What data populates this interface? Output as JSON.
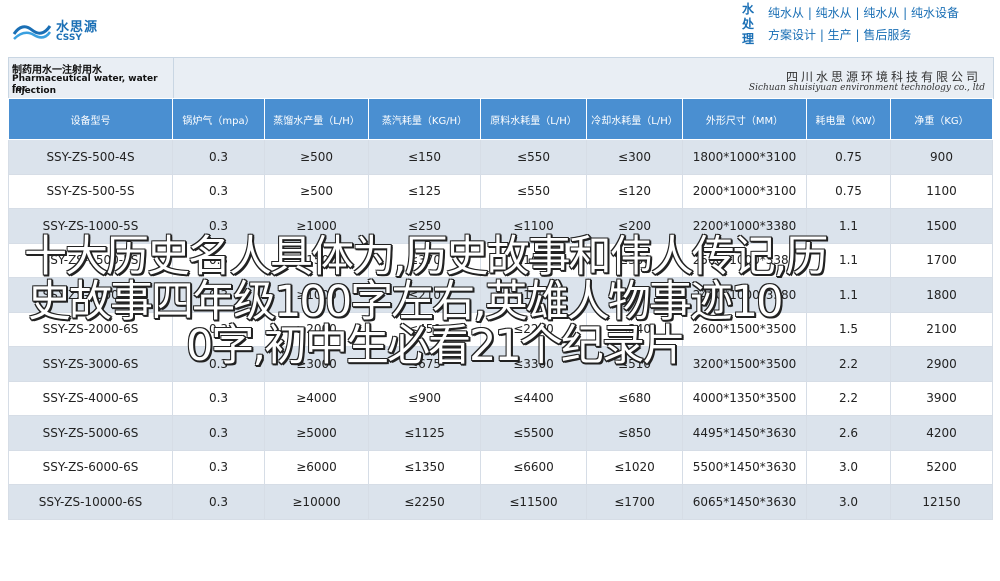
{
  "header": {
    "logo_cn": "水思源",
    "logo_en": "CSSY",
    "vertical_tag": "水处理",
    "tagline_1": "纯水从 | 纯水从 | 纯水从 | 纯水设备",
    "tagline_2": "方案设计 | 生产 | 售后服务"
  },
  "title": {
    "cn": "制药用水一注射用水",
    "en_line1": "Pharmaceutical water, water for",
    "en_line2": "injection",
    "company_cn": "四川水思源环境科技有限公司",
    "company_en": "Sichuan shuisiyuan environment technology co., ltd"
  },
  "table": {
    "headers": [
      "设备型号",
      "锅炉气（mpa）",
      "蒸馏水产量（L/H）",
      "蒸汽耗量（KG/H）",
      "原料水耗量（L/H）",
      "冷却水耗量（L/H）",
      "外形尺寸（MM）",
      "耗电量（KW）",
      "净重（KG）"
    ],
    "rows": [
      [
        "SSY-ZS-500-4S",
        "0.3",
        "≥500",
        "≤150",
        "≤550",
        "≤300",
        "1800*1000*3100",
        "0.75",
        "900"
      ],
      [
        "SSY-ZS-500-5S",
        "0.3",
        "≥500",
        "≤125",
        "≤550",
        "≤120",
        "2000*1000*3100",
        "0.75",
        "1100"
      ],
      [
        "SSY-ZS-1000-5S",
        "0.3",
        "≥1000",
        "≤250",
        "≤1100",
        "≤200",
        "2200*1000*3380",
        "1.1",
        "1500"
      ],
      [
        "SSY-ZS-1500-5S",
        "0.3",
        "≥1500",
        "≤370",
        "≤1650",
        "≤300",
        "2500*1000*3380",
        "1.1",
        "1700"
      ],
      [
        "SSY-ZS-1000-6S",
        "0.3",
        "≥1000",
        "≤210",
        "≤1100",
        "≤170",
        "2400*1000*3380",
        "1.1",
        "1800"
      ],
      [
        "SSY-ZS-2000-6S",
        "0.3",
        "≥2000",
        "≤450",
        "≤2200",
        "≤340",
        "2600*1500*3500",
        "1.5",
        "2100"
      ],
      [
        "SSY-ZS-3000-6S",
        "0.3",
        "≥3000",
        "≤675",
        "≤3300",
        "≤510",
        "3200*1500*3500",
        "2.2",
        "2900"
      ],
      [
        "SSY-ZS-4000-6S",
        "0.3",
        "≥4000",
        "≤900",
        "≤4400",
        "≤680",
        "4000*1350*3500",
        "2.2",
        "3900"
      ],
      [
        "SSY-ZS-5000-6S",
        "0.3",
        "≥5000",
        "≤1125",
        "≤5500",
        "≤850",
        "4495*1450*3630",
        "2.6",
        "4200"
      ],
      [
        "SSY-ZS-6000-6S",
        "0.3",
        "≥6000",
        "≤1350",
        "≤6600",
        "≤1020",
        "5500*1450*3630",
        "3.0",
        "5200"
      ],
      [
        "SSY-ZS-10000-6S",
        "0.3",
        "≥10000",
        "≤2250",
        "≤11500",
        "≤1700",
        "6065*1450*3630",
        "3.0",
        "12150"
      ]
    ]
  },
  "overlay": {
    "line1": "十大历史名人具体为,历史故事和伟人传记,历",
    "line2": "史故事四年级100字左右,英雄人物事迹10",
    "line3": "0字,初中生必看21个纪录片"
  }
}
